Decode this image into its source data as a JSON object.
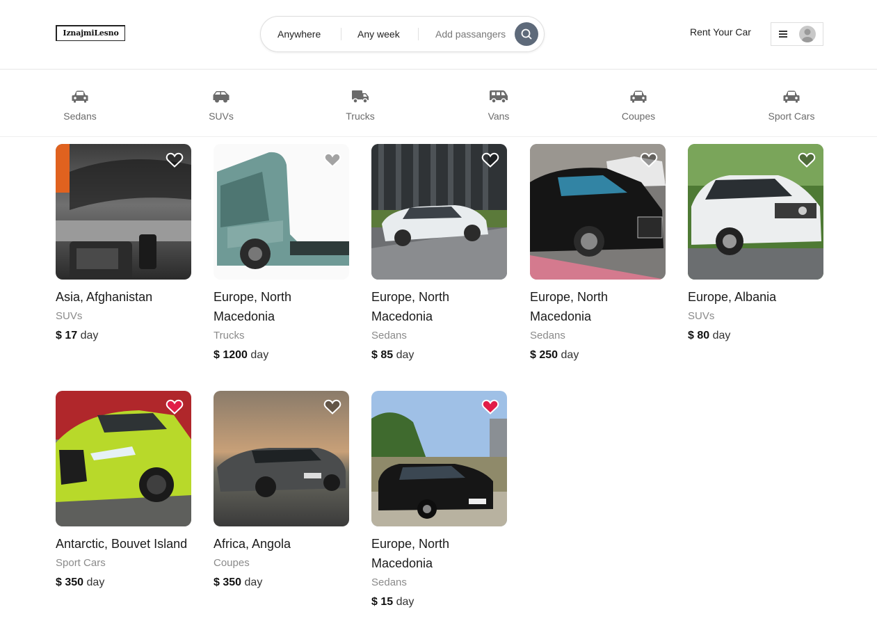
{
  "header": {
    "logo": "IznajmiLesno",
    "search": {
      "where": "Anywhere",
      "when": "Any week",
      "guests": "Add passangers"
    },
    "rent_link": "Rent Your Car"
  },
  "categories": [
    {
      "label": "Sedans",
      "icon": "car-icon"
    },
    {
      "label": "SUVs",
      "icon": "suv-icon"
    },
    {
      "label": "Trucks",
      "icon": "truck-icon"
    },
    {
      "label": "Vans",
      "icon": "van-icon"
    },
    {
      "label": "Coupes",
      "icon": "car-icon"
    },
    {
      "label": "Sport Cars",
      "icon": "car-icon"
    }
  ],
  "listings": [
    {
      "location": "Asia, Afghanistan",
      "category": "SUVs",
      "currency": "$",
      "price": "17",
      "unit": "day",
      "favorite": false
    },
    {
      "location": "Europe, North Macedonia",
      "category": "Trucks",
      "currency": "$",
      "price": "1200",
      "unit": "day",
      "favorite": false
    },
    {
      "location": "Europe, North Macedonia",
      "category": "Sedans",
      "currency": "$",
      "price": "85",
      "unit": "day",
      "favorite": false
    },
    {
      "location": "Europe, North Macedonia",
      "category": "Sedans",
      "currency": "$",
      "price": "250",
      "unit": "day",
      "favorite": false
    },
    {
      "location": "Europe, Albania",
      "category": "SUVs",
      "currency": "$",
      "price": "80",
      "unit": "day",
      "favorite": false
    },
    {
      "location": "Antarctic, Bouvet Island",
      "category": "Sport Cars",
      "currency": "$",
      "price": "350",
      "unit": "day",
      "favorite": true
    },
    {
      "location": "Africa, Angola",
      "category": "Coupes",
      "currency": "$",
      "price": "350",
      "unit": "day",
      "favorite": false
    },
    {
      "location": "Europe, North Macedonia",
      "category": "Sedans",
      "currency": "$",
      "price": "15",
      "unit": "day",
      "favorite": true
    }
  ],
  "colors": {
    "accent": "#5e6a7a",
    "favorite": "#e11d48",
    "muted_text": "#8a8a8a"
  }
}
